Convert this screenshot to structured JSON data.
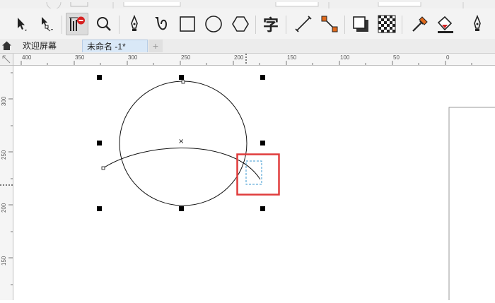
{
  "tabs": [
    {
      "label": "欢迎屏幕"
    },
    {
      "label": "未命名 -1*"
    }
  ],
  "new_tab_symbol": "+",
  "ruler_top_labels": [
    "400",
    "350",
    "300",
    "250",
    "200",
    "150",
    "100",
    "50",
    "0"
  ],
  "ruler_left_labels": [
    "300",
    "250",
    "200",
    "150"
  ],
  "canvas_objects": {
    "center_marker": "×"
  },
  "colors": {
    "highlight_box": "#e03c3c",
    "active_tab": "#d9e8f7",
    "selection_handle": "#000000",
    "dashed_box": "#3d9ad1"
  },
  "tools": [
    "pick-tool-icon",
    "shape-edit-tool-icon",
    "crop-tool-icon",
    "zoom-tool-icon",
    "freehand-pen-tool-icon",
    "artistic-media-tool-icon",
    "rectangle-tool-icon",
    "ellipse-tool-icon",
    "polygon-tool-icon",
    "text-tool-icon",
    "dimension-tool-icon",
    "connector-tool-icon",
    "drop-shadow-tool-icon",
    "transparency-tool-icon",
    "eyedropper-tool-icon",
    "fill-tool-icon",
    "smart-fill-tool-icon"
  ],
  "text_tool_glyph": "字"
}
